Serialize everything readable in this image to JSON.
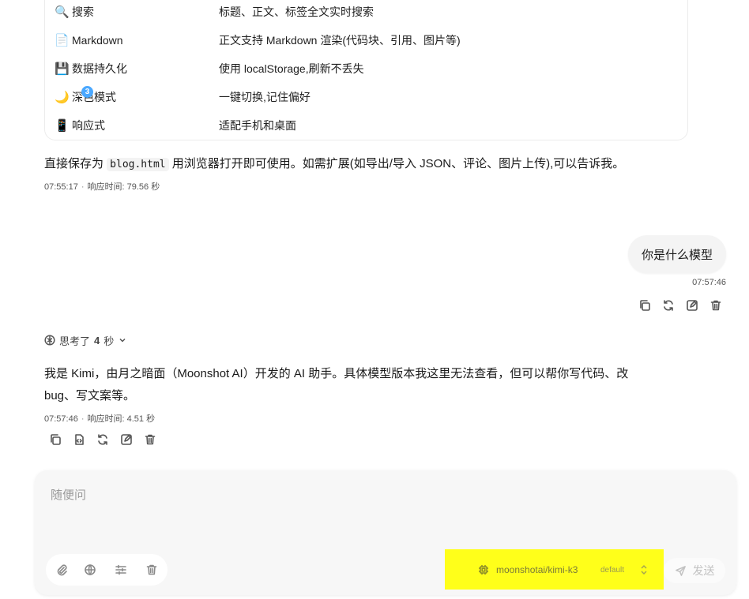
{
  "features": [
    {
      "icon": "🔍",
      "icon_name": "magnifier-icon",
      "name": "搜索",
      "desc": "标题、正文、标签全文实时搜索"
    },
    {
      "icon": "📄",
      "icon_name": "document-icon",
      "name": "Markdown",
      "desc": "正文支持 Markdown 渲染(代码块、引用、图片等)"
    },
    {
      "icon": "💾",
      "icon_name": "floppy-disk-icon",
      "name": "数据持久化",
      "desc": "使用 localStorage,刷新不丢失"
    },
    {
      "icon": "🌙",
      "icon_name": "moon-icon",
      "name": "深色模式",
      "desc": "一键切换,记住偏好"
    },
    {
      "icon": "📱",
      "icon_name": "phone-icon",
      "name": "响应式",
      "desc": "适配手机和桌面"
    }
  ],
  "prev_answer": {
    "text_before": "直接保存为 ",
    "code": "blog.html",
    "text_after": " 用浏览器打开即可使用。如需扩展(如导出/导入 JSON、评论、图片上传),可以告诉我。",
    "time": "07:55:17",
    "response_time": "响应时间: 79.56 秒"
  },
  "user_message": {
    "text": "你是什么模型",
    "time": "07:57:46"
  },
  "thinking": {
    "label_prefix": "思考了",
    "seconds": "4",
    "label_suffix": "秒"
  },
  "answer": {
    "line1": "我是 Kimi，由月之暗面（Moonshot AI）开发的 AI 助手。具体模型版本我这里无法查看，但可以帮你写代码、改",
    "line2": "bug、写文案等。",
    "time": "07:57:46",
    "response_time": "响应时间: 4.51 秒"
  },
  "composer": {
    "placeholder": "随便问",
    "tools_badge": "3",
    "model_name": "moonshotai/kimi-k3",
    "model_tag": "default",
    "send_label": "发送"
  },
  "colors": {
    "highlight": "#ffff1a",
    "badge": "#4aa8ff"
  }
}
